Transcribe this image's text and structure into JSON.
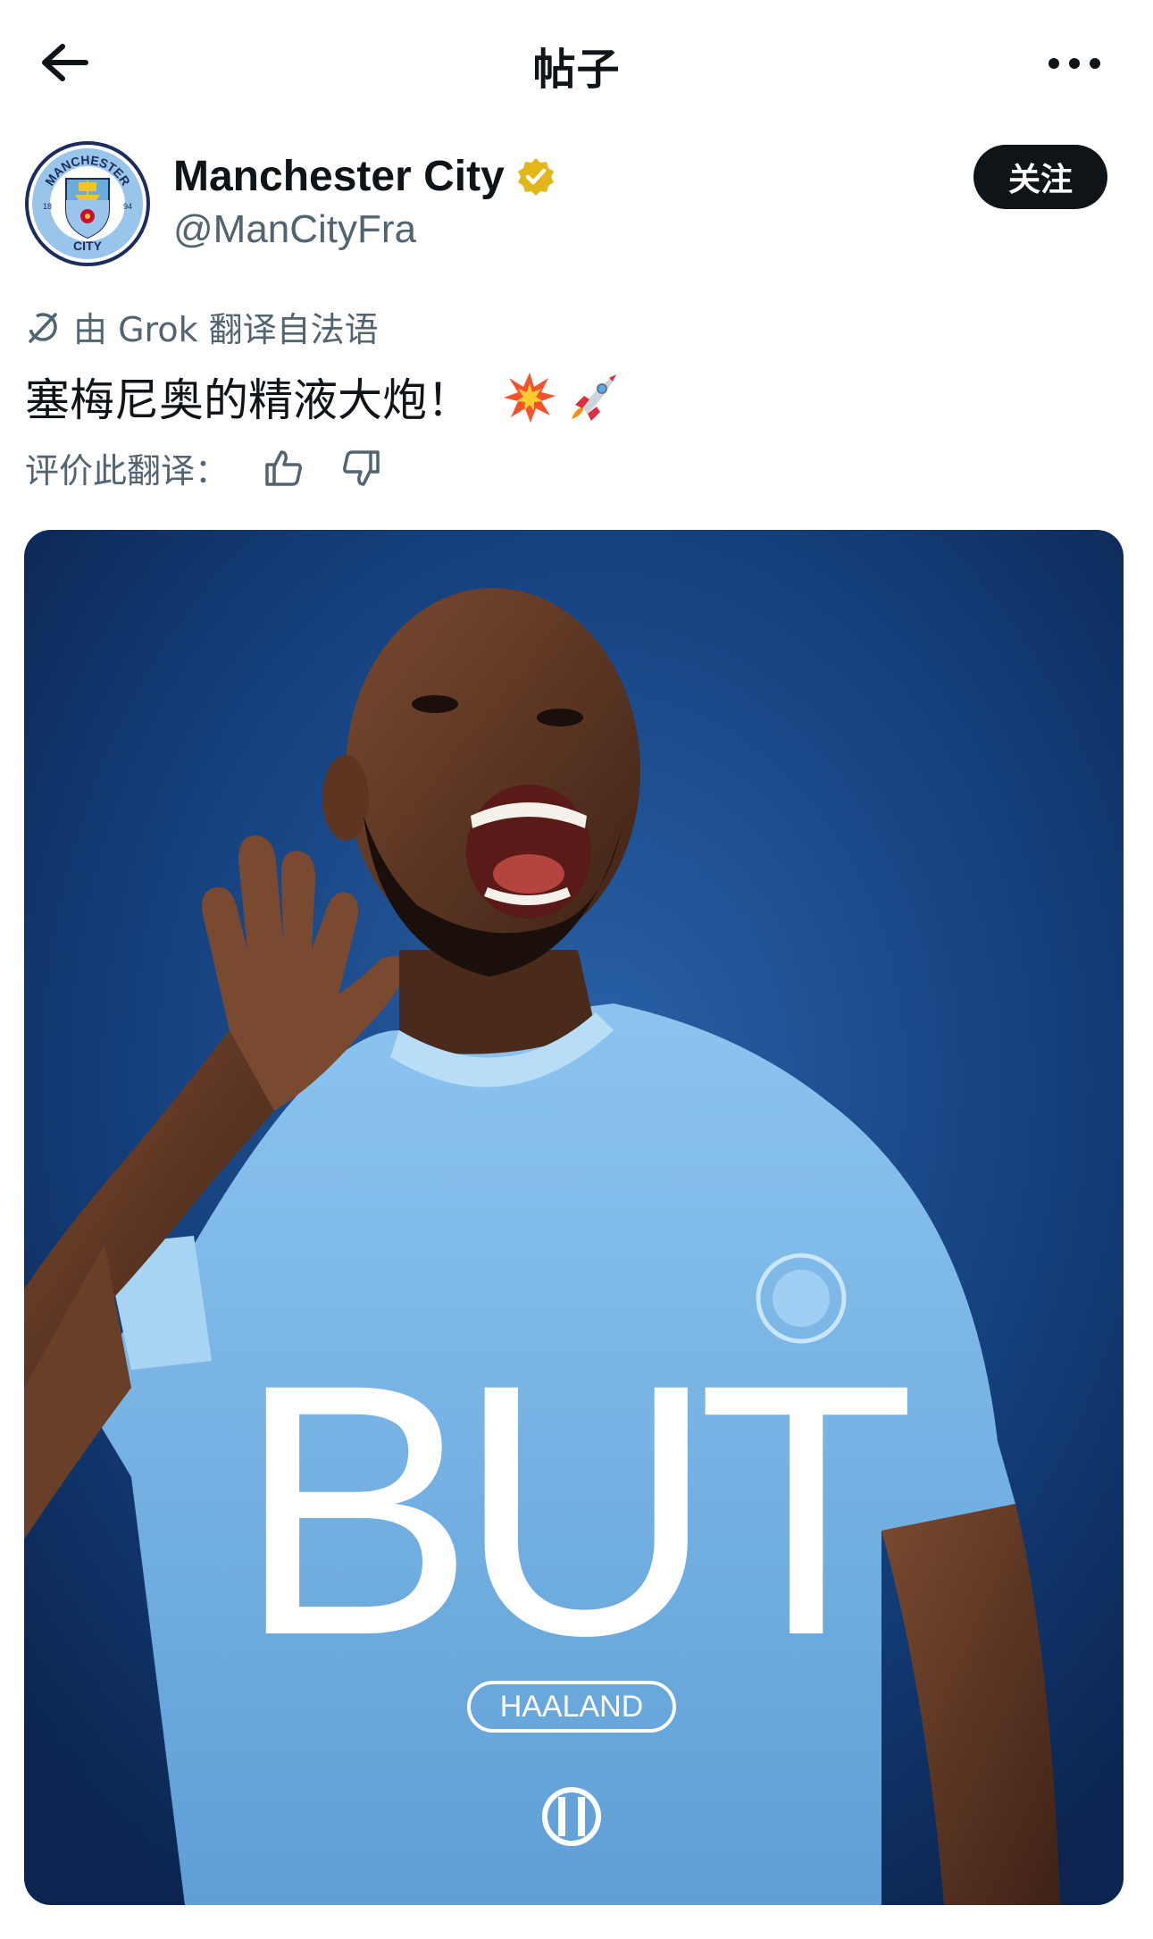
{
  "header": {
    "title": "帖子",
    "back_icon": "arrow-left-icon",
    "more_icon": "more-horizontal-icon"
  },
  "author": {
    "name": "Manchester City",
    "handle": "@ManCityFra",
    "verified_color": "#e2b719",
    "follow_label": "关注",
    "avatar_text_top": "MANCHESTER",
    "avatar_text_bottom": "CITY",
    "avatar_year_left": "18",
    "avatar_year_right": "94"
  },
  "translation": {
    "label": "由 Grok 翻译自法语",
    "icon": "grok-icon"
  },
  "post": {
    "text": "塞梅尼奥的精液大炮！",
    "emojis": [
      "collision-emoji",
      "rocket-emoji"
    ]
  },
  "rating": {
    "label": "评价此翻译：",
    "thumbs_up_icon": "thumbs-up-icon",
    "thumbs_down_icon": "thumbs-down-icon"
  },
  "media": {
    "headline": "BUT",
    "tag": "HAALAND",
    "background_color": "#143f7c",
    "shirt_color": "#7bb8e8"
  }
}
